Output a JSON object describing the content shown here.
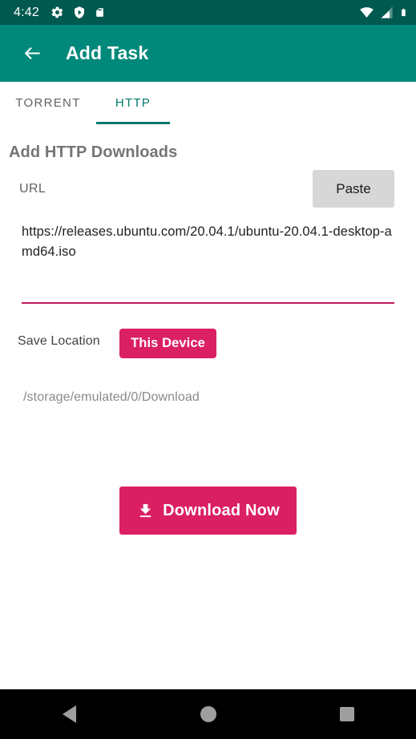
{
  "status_bar": {
    "time": "4:42",
    "left_icons": [
      "gear-icon",
      "shield-play-icon",
      "sd-card-icon"
    ],
    "right_icons": [
      "wifi-icon",
      "cellular-signal-icon",
      "battery-icon"
    ],
    "background_color": "#00594F"
  },
  "app_bar": {
    "back_icon": "back-arrow-icon",
    "title": "Add Task",
    "background_color": "#00897B"
  },
  "tabs": {
    "items": [
      {
        "label": "TORRENT",
        "active": false
      },
      {
        "label": "HTTP",
        "active": true
      }
    ],
    "active_color": "#00796B",
    "inactive_color": "#616161"
  },
  "form": {
    "section_title": "Add HTTP Downloads",
    "url_label": "URL",
    "paste_button": "Paste",
    "url_value": "https://releases.ubuntu.com/20.04.1/ubuntu-20.04.1-desktop-amd64.iso",
    "url_placeholder": "URL",
    "underline_color": "#C2185B",
    "save_location_label": "Save Location",
    "save_location_button": "This Device",
    "save_path": "/storage/emulated/0/Download",
    "download_button": "Download Now",
    "download_icon": "download-save-alt-icon",
    "accent_color": "#DB1F63"
  },
  "nav_bar": {
    "buttons": [
      "back-triangle-icon",
      "home-circle-icon",
      "recents-square-icon"
    ],
    "background_color": "#000000",
    "icon_color": "#9E9E9E"
  }
}
